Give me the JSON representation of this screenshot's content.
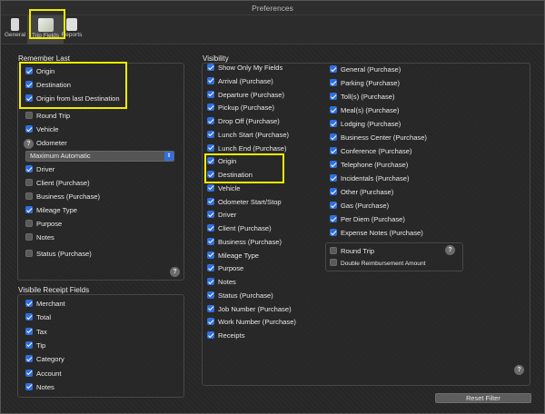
{
  "window": {
    "title": "Preferences"
  },
  "toolbar": {
    "general": "General",
    "trip_fields": "Trip Fields",
    "reports": "Reports"
  },
  "remember_last": {
    "title": "Remember Last",
    "origin": "Origin",
    "destination": "Destination",
    "origin_from_last": "Origin from last Destination",
    "round_trip": "Round Trip",
    "vehicle": "Vehicle",
    "odometer": "Odometer",
    "odometer_select": "Maximum Automatic",
    "driver": "Driver",
    "client": "Client (Purchase)",
    "business": "Business (Purchase)",
    "mileage_type": "Mileage Type",
    "purpose": "Purpose",
    "notes": "Notes",
    "status": "Status (Purchase)"
  },
  "receipt": {
    "title": "Visibile Receipt Fields",
    "items": [
      "Merchant",
      "Total",
      "Tax",
      "Tip",
      "Category",
      "Account",
      "Notes"
    ]
  },
  "visibility": {
    "title": "Visibility",
    "col1": [
      {
        "label": "Show Only My Fields",
        "on": true
      },
      {
        "label": "Arrival (Purchase)",
        "on": true
      },
      {
        "label": "Departure (Purchase)",
        "on": true
      },
      {
        "label": "Pickup (Purchase)",
        "on": true
      },
      {
        "label": "Drop Off (Purchase)",
        "on": true
      },
      {
        "label": "Lunch Start (Purchase)",
        "on": true
      },
      {
        "label": "Lunch End (Purchase)",
        "on": true
      },
      {
        "label": "Origin",
        "on": true
      },
      {
        "label": "Destination",
        "on": true
      },
      {
        "label": "Vehicle",
        "on": true
      },
      {
        "label": "Odometer Start/Stop",
        "on": true
      },
      {
        "label": "Driver",
        "on": true
      },
      {
        "label": "Client (Purchase)",
        "on": true
      },
      {
        "label": "Business (Purchase)",
        "on": true
      },
      {
        "label": "Mileage Type",
        "on": true
      },
      {
        "label": "Purpose",
        "on": true
      },
      {
        "label": "Notes",
        "on": true
      },
      {
        "label": "Status (Purchase)",
        "on": true
      },
      {
        "label": "Job Number (Purchase)",
        "on": true
      },
      {
        "label": "Work Number (Purchase)",
        "on": true
      },
      {
        "label": "Receipts",
        "on": true
      }
    ],
    "col2": [
      "General (Purchase)",
      "Parking (Purchase)",
      "Toll(s) (Purchase)",
      "Meal(s) (Purchase)",
      "Lodging (Purchase)",
      "Business Center (Purchase)",
      "Conference (Purchase)",
      "Telephone (Purchase)",
      "Incidentals (Purchase)",
      "Other (Purchase)",
      "Gas (Purchase)",
      "Per Diem (Purchase)",
      "Expense Notes (Purchase)"
    ],
    "round_trip": "Round Trip",
    "double_reimbursement": "Double Reimbursement Amount"
  },
  "reset_filter": "Reset Filter",
  "colors": {
    "accent": "#2f6fe0",
    "highlight": "#f2ec00"
  }
}
